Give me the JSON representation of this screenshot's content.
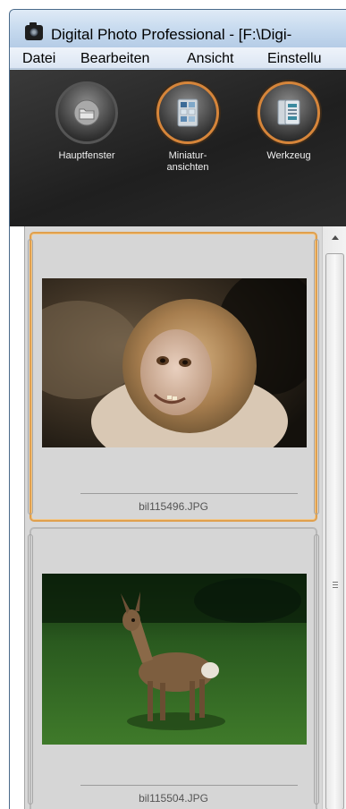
{
  "window": {
    "title": "Digital Photo Professional - [F:\\Digi-"
  },
  "menubar": {
    "items": [
      "Datei",
      "Bearbeiten",
      "Ansicht",
      "Einstellu"
    ]
  },
  "toolbar": {
    "buttons": [
      {
        "label": "Hauptfenster",
        "icon": "folder-icon"
      },
      {
        "label": "Miniatur-\nansichten",
        "icon": "thumbnail-view-icon"
      },
      {
        "label": "Werkzeug",
        "icon": "tool-palette-icon"
      }
    ]
  },
  "thumbnails": [
    {
      "filename": "bil115496.JPG",
      "selected": true,
      "subject": "monkey-photo"
    },
    {
      "filename": "bil115504.JPG",
      "selected": false,
      "subject": "deer-photo"
    }
  ],
  "colors": {
    "selection_border": "#e0a04e",
    "toolbar_bg": "#262626",
    "pane_bg": "#d8d8d8"
  }
}
